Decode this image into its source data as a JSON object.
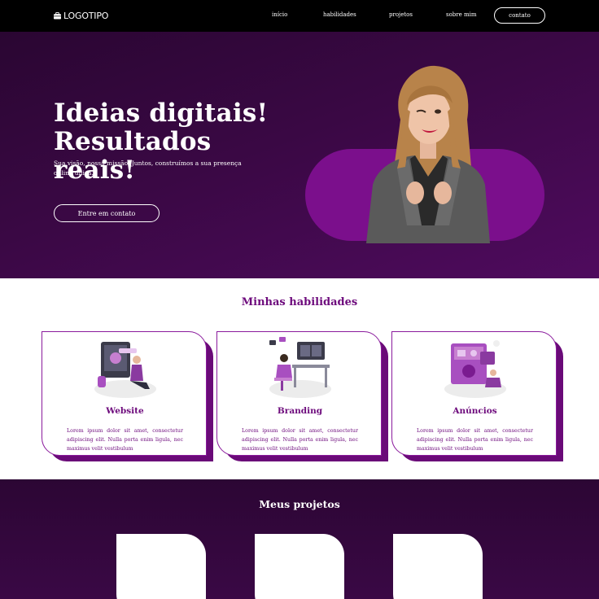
{
  "nav": {
    "logo_text": "LOGOTIPO",
    "links": [
      "início",
      "habilidades",
      "projetos",
      "sobre mim"
    ],
    "contact_label": "contato"
  },
  "hero": {
    "title_line1": "Ideias digitais!",
    "title_line2": "Resultados reais!",
    "subtitle": "Sua visão, nossa missão. Juntos, construímos a sua presença online única.",
    "cta_label": "Entre em contato",
    "photo": "woman-in-gray-blazer-winking"
  },
  "skills": {
    "title": "Minhas habilidades",
    "cards": [
      {
        "title": "Website",
        "illustration": "person-coding-at-laptop",
        "text": "Lorem ipsum dolor sit amet, consectetur adipiscing elit. Nulla porta enim ligula, nec maximus velit vestibulum"
      },
      {
        "title": "Branding",
        "illustration": "person-at-desk-with-monitors",
        "text": "Lorem ipsum dolor sit amet, consectetur adipiscing elit. Nulla porta enim ligula, nec maximus velit vestibulum"
      },
      {
        "title": "Anúncios",
        "illustration": "person-with-ad-screens",
        "text": "Lorem ipsum dolor sit amet, consectetur adipiscing elit. Nulla porta enim ligula, nec maximus velit vestibulum"
      }
    ]
  },
  "projects": {
    "title": "Meus projetos"
  },
  "colors": {
    "primary": "#6d0a7c",
    "hero_bg": "#3a0844",
    "pill": "#7b0f8c",
    "nav_bg": "#000000"
  }
}
